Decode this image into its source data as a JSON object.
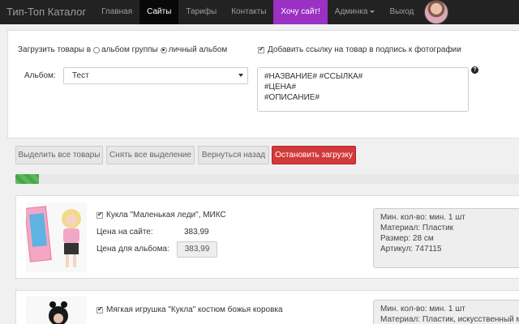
{
  "nav": {
    "brand": "Тип-Топ Каталог",
    "items": [
      {
        "label": "Главная"
      },
      {
        "label": "Сайты"
      },
      {
        "label": "Тарифы"
      },
      {
        "label": "Контакты"
      },
      {
        "label": "Хочу сайт!"
      },
      {
        "label": "Админка"
      },
      {
        "label": "Выход"
      }
    ],
    "promo_color": "#9b30c4"
  },
  "settings": {
    "upload_prefix": "Загрузить товары в",
    "option_group": "альбом группы",
    "option_personal": "личный альбом",
    "add_link_label": "Добавить ссылку на товар в подпись к фотографии",
    "album_label": "Альбом:",
    "album_value": "Тест",
    "template_text": "#НАЗВАНИЕ# #ССЫЛКА#\n#ЦЕНА#\n#ОПИСАНИЕ#"
  },
  "actions": {
    "select_all": "Выделить все товары",
    "deselect_all": "Снять все выделение",
    "back": "Вернуться назад",
    "stop": "Остановить загрузку"
  },
  "progress": {
    "value": 0.045,
    "color": "#5cb85c"
  },
  "products": [
    {
      "title": "Кукла \"Маленькая леди\", МИКС",
      "site_price_label": "Цена на сайте:",
      "site_price": "383,99",
      "album_price_label": "Цена для альбома:",
      "album_price": "383,99",
      "specs": [
        "Мин. кол-во: мин. 1 шт",
        "Материал: Пластик",
        "Размер: 28 см",
        "Артикул: 747115"
      ]
    },
    {
      "title": "Мягкая игрушка \"Кукла\" костюм божья коровка",
      "specs": [
        "Мин. кол-во: мин. 1 шт",
        "Материал: Пластик, искусственный мех"
      ]
    }
  ]
}
